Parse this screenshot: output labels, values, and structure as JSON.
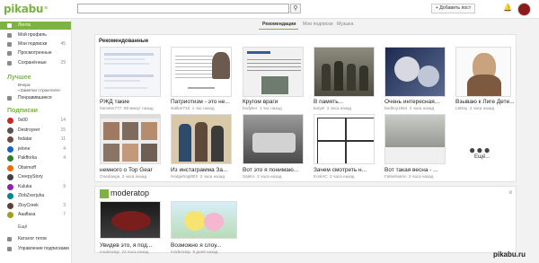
{
  "logo": "pikabu",
  "header": {
    "add_post": "+ Добавить пост"
  },
  "tabs": [
    "Рекомендации",
    "Мои подписки",
    "Музыка"
  ],
  "sidebar": {
    "items": [
      {
        "label": "Лента",
        "count": "",
        "active": true
      },
      {
        "label": "Мой профиль",
        "count": "",
        "active": false
      },
      {
        "label": "Мои подписки",
        "count": "45",
        "active": false
      },
      {
        "label": "Просмотренные",
        "count": "",
        "active": false
      },
      {
        "label": "Сохранённые",
        "count": "29",
        "active": false
      }
    ],
    "best_heading": "Лучшее",
    "best_line1": "Вчера",
    "best_line2": "«Заметки строителя»",
    "best_line3": "Понравившиеся",
    "subs_heading": "Подписки",
    "subs": [
      {
        "name": "0x00",
        "count": "14",
        "color": "#c62828"
      },
      {
        "name": "Destroyeer",
        "count": "15",
        "color": "#555555"
      },
      {
        "name": "fedatar",
        "count": "11",
        "color": "#6d4c41"
      },
      {
        "name": "jelone",
        "count": "4",
        "color": "#1565c0"
      },
      {
        "name": "Pakfforka",
        "count": "4",
        "color": "#2e7d32"
      },
      {
        "name": "Obsimoff",
        "count": "",
        "color": "#ef6c00"
      },
      {
        "name": "CreepyStory",
        "count": "",
        "color": "#424242"
      },
      {
        "name": "Kuluka",
        "count": "9",
        "color": "#8e24aa"
      },
      {
        "name": "ZlobZverjuha",
        "count": "",
        "color": "#00838f"
      },
      {
        "name": "ZloyCreek",
        "count": "3",
        "color": "#5d4037"
      },
      {
        "name": "Aaaflasa",
        "count": "7",
        "color": "#9e9d24"
      }
    ],
    "more": "Ещё",
    "catalog": "Каталог тегов",
    "manage": "Управление подписками"
  },
  "recommended": {
    "title": "Рекомендованные",
    "posts": [
      {
        "title": "РЖД такие",
        "author": "hamster777",
        "time": "59 минут назад"
      },
      {
        "title": "Патриотизм - это не...",
        "author": "stalker716",
        "time": "1 час назад"
      },
      {
        "title": "Кругом враги",
        "author": "bodyker",
        "time": "1 час назад"
      },
      {
        "title": "В память...",
        "author": "karyel",
        "time": "2 часа назад"
      },
      {
        "title": "Очень интересная...",
        "author": "bedboy1984",
        "time": "2 часа назад"
      },
      {
        "title": "Взываю к Лиге Дете...",
        "author": "L6Day",
        "time": "2 часа назад"
      },
      {
        "title": "немного о Top Gear",
        "author": "Onedawga",
        "time": "2 часа назад"
      },
      {
        "title": "Из инстаграмма За...",
        "author": "Hedgehog80th",
        "time": "2 часа назад"
      },
      {
        "title": "Вот это я понимаю...",
        "author": "SatiKo",
        "time": "2 часа назад"
      },
      {
        "title": "Зачем смотреть н...",
        "author": "KoolAC",
        "time": "2 часа назад"
      },
      {
        "title": "Вот такая весна - ...",
        "author": "FalseIlusion",
        "time": "2 часа назад"
      }
    ],
    "more_label": "Ещё..."
  },
  "moderatop": {
    "name": "moderatop",
    "posts": [
      {
        "title": "Увидев это, я под...",
        "author": "moderatop",
        "time": "22 часа назад"
      },
      {
        "title": "Возможно я слоу...",
        "author": "moderatop",
        "time": "9 дней назад"
      }
    ]
  },
  "watermark": "pikabu.ru"
}
